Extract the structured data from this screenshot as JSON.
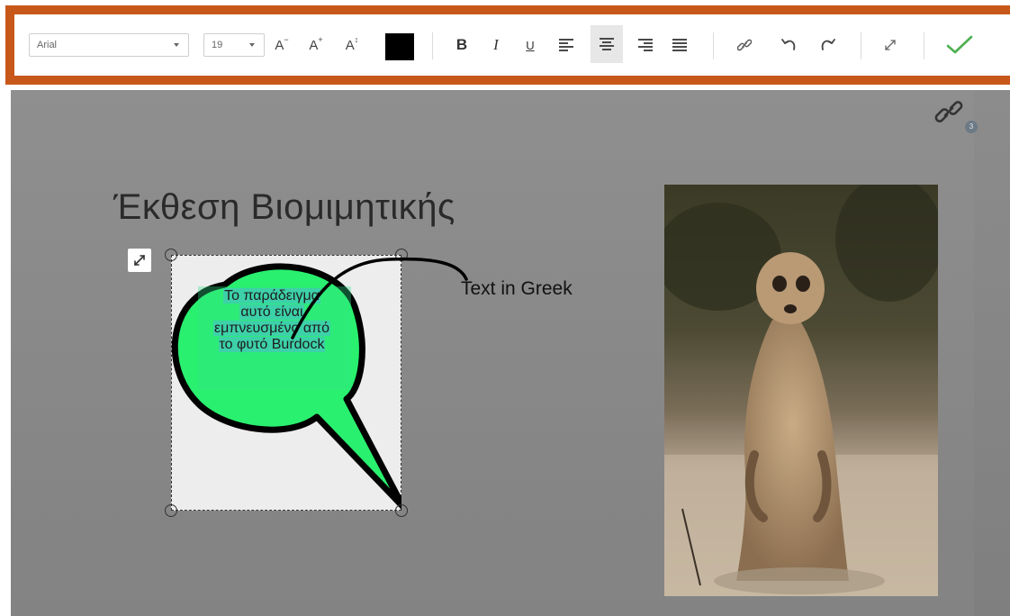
{
  "toolbar": {
    "font_family": "Arial",
    "font_size": "19",
    "decrease_font": "A",
    "increase_font": "A",
    "auto_size": "A",
    "text_color": "#000000",
    "bold": "B",
    "italic": "I",
    "underline": "U",
    "alignment_active": "center",
    "accent_border_color": "#c8571a",
    "confirm_color": "#4caf50"
  },
  "link_badge": {
    "count": "3"
  },
  "slide": {
    "title": "Έκθεση Βιομιμητικής",
    "bubble": {
      "lines": [
        "Το παράδειγμα",
        "αυτό είναι",
        "εμπνευσμένο από",
        "το φυτό Burdock"
      ],
      "fill_color": "#29f06e"
    },
    "annotation": "Text in Greek",
    "photo_subject": "meerkat"
  }
}
